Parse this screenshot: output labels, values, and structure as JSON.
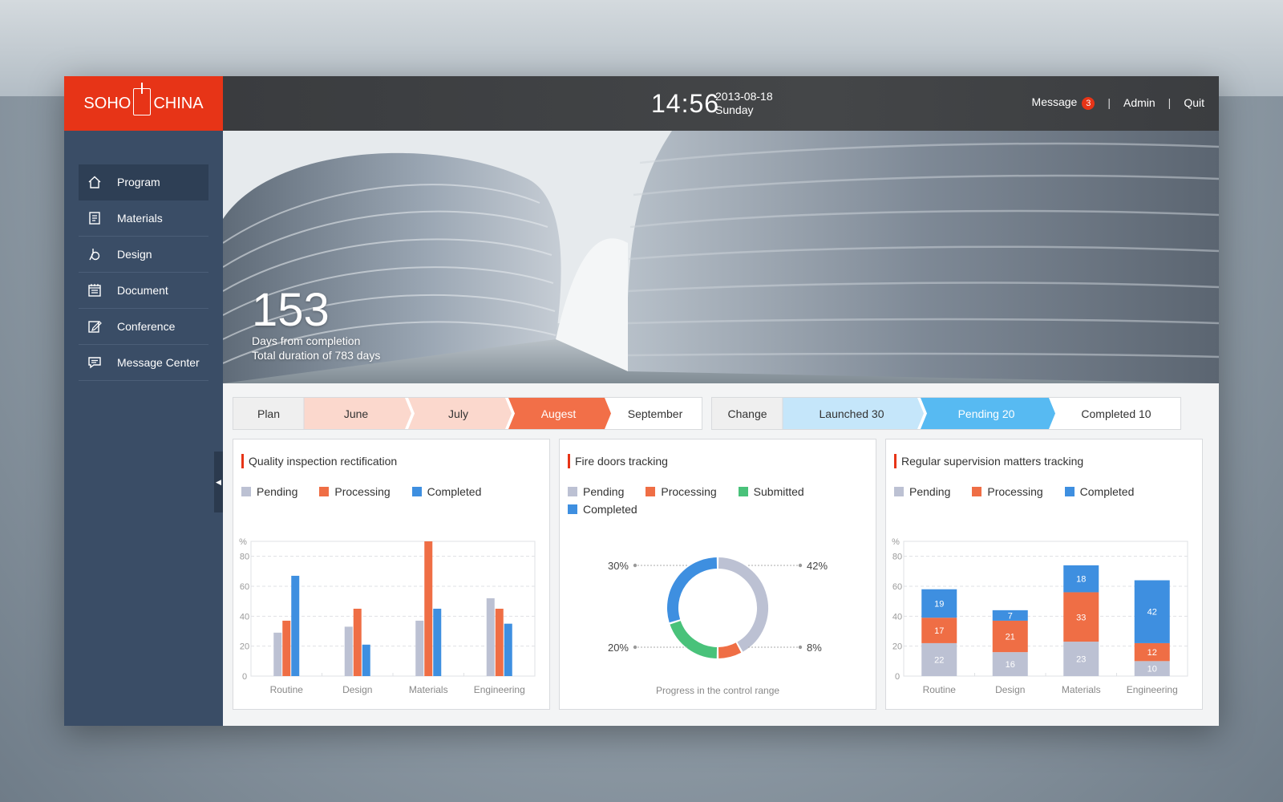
{
  "brand": {
    "left": "SOHO",
    "right": "CHINA"
  },
  "header": {
    "time": "14:56",
    "date": "2013-08-18",
    "weekday": "Sunday",
    "message_label": "Message",
    "message_count": "3",
    "admin_label": "Admin",
    "quit_label": "Quit"
  },
  "sidebar": {
    "items": [
      {
        "label": "Program",
        "icon": "home-icon"
      },
      {
        "label": "Materials",
        "icon": "materials-icon"
      },
      {
        "label": "Design",
        "icon": "design-icon"
      },
      {
        "label": "Document",
        "icon": "document-icon"
      },
      {
        "label": "Conference",
        "icon": "conference-icon"
      },
      {
        "label": "Message Center",
        "icon": "message-center-icon"
      }
    ]
  },
  "hero": {
    "days": "153",
    "line1": "Days from completion",
    "line2": "Total duration of 783 days"
  },
  "plan_bar": {
    "steps": [
      "Plan",
      "June",
      "July",
      "Augest",
      "September"
    ]
  },
  "change_bar": {
    "steps": [
      "Change",
      "Launched 30",
      "Pending 20",
      "Completed 10"
    ]
  },
  "colors": {
    "accent": "#e73417",
    "pending": "#bcc1d3",
    "processing": "#ef6e45",
    "completed": "#3e8fe0",
    "submitted": "#49c27a"
  },
  "panels": {
    "quality": {
      "title": "Quality inspection rectification",
      "legend": [
        "Pending",
        "Processing",
        "Completed"
      ]
    },
    "fire": {
      "title": "Fire doors tracking",
      "legend": [
        "Pending",
        "Processing",
        "Submitted",
        "Completed"
      ],
      "caption": "Progress in the control range"
    },
    "supervision": {
      "title": "Regular supervision matters tracking",
      "legend": [
        "Pending",
        "Processing",
        "Completed"
      ]
    }
  },
  "chart_data": [
    {
      "type": "bar",
      "title": "Quality inspection rectification",
      "ylabel": "%",
      "ylim": [
        0,
        90
      ],
      "yticks": [
        0,
        20,
        40,
        60,
        80
      ],
      "categories": [
        "Routine",
        "Design",
        "Materials",
        "Engineering"
      ],
      "series": [
        {
          "name": "Pending",
          "values": [
            29,
            33,
            37,
            52
          ]
        },
        {
          "name": "Processing",
          "values": [
            37,
            45,
            90,
            45
          ]
        },
        {
          "name": "Completed",
          "values": [
            67,
            21,
            45,
            35
          ]
        }
      ],
      "grid": true
    },
    {
      "type": "pie",
      "title": "Fire doors tracking",
      "style": "donut",
      "series": [
        {
          "name": "Pending",
          "value": 42
        },
        {
          "name": "Processing",
          "value": 8
        },
        {
          "name": "Submitted",
          "value": 20
        },
        {
          "name": "Completed",
          "value": 30
        }
      ],
      "labels": [
        "42%",
        "8%",
        "20%",
        "30%"
      ],
      "xlabel": "Progress in the control range"
    },
    {
      "type": "bar",
      "stacked": true,
      "title": "Regular supervision matters tracking",
      "ylabel": "%",
      "ylim": [
        0,
        90
      ],
      "yticks": [
        0,
        20,
        40,
        60,
        80
      ],
      "categories": [
        "Routine",
        "Design",
        "Materials",
        "Engineering"
      ],
      "series": [
        {
          "name": "Pending",
          "values": [
            22,
            16,
            23,
            10
          ]
        },
        {
          "name": "Processing",
          "values": [
            17,
            21,
            33,
            12
          ]
        },
        {
          "name": "Completed",
          "values": [
            19,
            7,
            18,
            42
          ]
        }
      ],
      "grid": true
    }
  ]
}
